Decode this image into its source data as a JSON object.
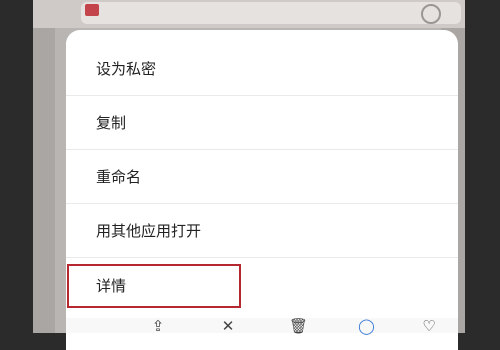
{
  "menu": {
    "items": [
      {
        "label": "设为私密",
        "name": "menu-item-set-private"
      },
      {
        "label": "复制",
        "name": "menu-item-copy"
      },
      {
        "label": "重命名",
        "name": "menu-item-rename"
      },
      {
        "label": "用其他应用打开",
        "name": "menu-item-open-with"
      },
      {
        "label": "详情",
        "name": "menu-item-details"
      }
    ]
  },
  "toolbar": {
    "icons": [
      "share-icon",
      "close-icon",
      "delete-icon",
      "info-icon",
      "favorite-icon"
    ]
  },
  "colors": {
    "highlight": "#b5282f",
    "menu_background": "#ffffff",
    "backdrop": "#b9b5b3"
  }
}
